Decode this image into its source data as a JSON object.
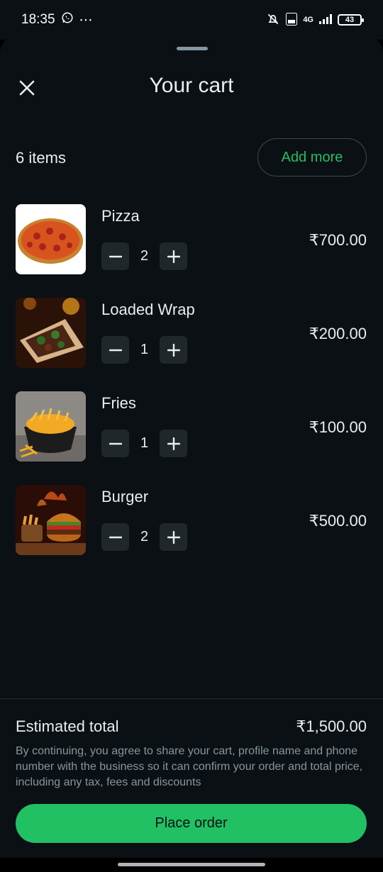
{
  "status_bar": {
    "time": "18:35",
    "more": "⋯",
    "network": "4G",
    "battery": "43",
    "icons": [
      "whatsapp-icon",
      "mute-bell-icon",
      "volte-icon",
      "signal-icon",
      "battery-icon"
    ]
  },
  "header": {
    "title": "Your cart",
    "close_icon": "close-icon"
  },
  "summary": {
    "items_count": "6 items",
    "add_more_label": "Add more"
  },
  "items": [
    {
      "name": "Pizza",
      "quantity": "2",
      "price": "₹700.00"
    },
    {
      "name": "Loaded Wrap",
      "quantity": "1",
      "price": "₹200.00"
    },
    {
      "name": "Fries",
      "quantity": "1",
      "price": "₹100.00"
    },
    {
      "name": "Burger",
      "quantity": "2",
      "price": "₹500.00"
    }
  ],
  "footer": {
    "estimated_label": "Estimated total",
    "estimated_value": "₹1,500.00",
    "disclaimer": "By continuing, you agree to share your cart, profile name and phone number with the business so it can confirm your order and total price, including any tax, fees and discounts",
    "place_order_label": "Place order"
  },
  "colors": {
    "background": "#0b1014",
    "accent": "#21c063",
    "button_bg": "#1f272a",
    "muted_text": "#8696a0"
  }
}
